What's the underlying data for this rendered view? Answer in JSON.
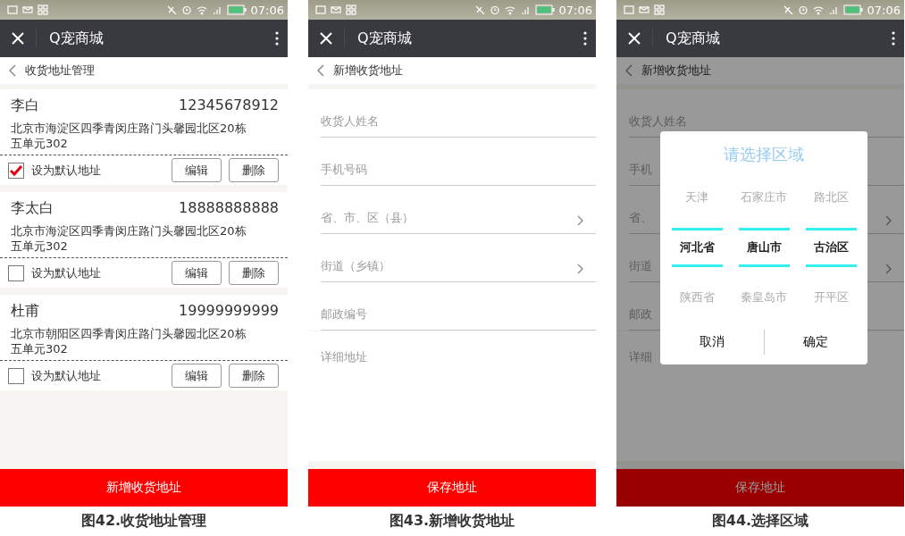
{
  "screens": [
    {
      "kind": "address_list",
      "time": "07:06",
      "app_title": "Q宠商城",
      "page_title": "收货地址管理",
      "addresses": [
        {
          "name": "李白",
          "phone": "12345678912",
          "address": "北京市海淀区四季青闵庄路门头馨园北区20栋五单元302",
          "default_label": "设为默认地址",
          "checked": true,
          "edit": "编辑",
          "delete": "删除"
        },
        {
          "name": "李太白",
          "phone": "18888888888",
          "address": "北京市海淀区四季青闵庄路门头馨园北区20栋五单元302",
          "default_label": "设为默认地址",
          "checked": false,
          "edit": "编辑",
          "delete": "删除"
        },
        {
          "name": "杜甫",
          "phone": "19999999999",
          "address": "北京市朝阳区四季青闵庄路门头馨园北区20栋五单元302",
          "default_label": "设为默认地址",
          "checked": false,
          "edit": "编辑",
          "delete": "删除"
        }
      ],
      "bottom_button": "新增收货地址",
      "caption": "图42.收货地址管理"
    },
    {
      "kind": "new_address",
      "time": "07:06",
      "app_title": "Q宠商城",
      "page_title": "新增收货地址",
      "fields": [
        {
          "placeholder": "收货人姓名",
          "chevron": false
        },
        {
          "placeholder": "手机号码",
          "chevron": false
        },
        {
          "placeholder": "省、市、区（县）",
          "chevron": true
        },
        {
          "placeholder": "街道（乡镇）",
          "chevron": true
        },
        {
          "placeholder": "邮政编号",
          "chevron": false
        }
      ],
      "detail_placeholder": "详细地址",
      "bottom_button": "保存地址",
      "caption": "图43.新增收货地址"
    },
    {
      "kind": "region_picker",
      "time": "07:06",
      "app_title": "Q宠商城",
      "page_title": "新增收货地址",
      "fields": [
        {
          "placeholder": "收货人姓名",
          "chevron": false
        },
        {
          "placeholder": "手机",
          "chevron": false
        },
        {
          "placeholder": "省、",
          "chevron": true
        },
        {
          "placeholder": "街道",
          "chevron": true
        },
        {
          "placeholder": "邮政",
          "chevron": false
        }
      ],
      "detail_placeholder": "详细",
      "bottom_button": "保存地址",
      "caption": "图44.选择区域",
      "dialog": {
        "title": "请选择区域",
        "columns": [
          [
            {
              "label": "天津",
              "selected": false
            },
            {
              "label": "河北省",
              "selected": true
            },
            {
              "label": "陕西省",
              "selected": false
            }
          ],
          [
            {
              "label": "石家庄市",
              "selected": false
            },
            {
              "label": "唐山市",
              "selected": true
            },
            {
              "label": "秦皇岛市",
              "selected": false
            }
          ],
          [
            {
              "label": "路北区",
              "selected": false
            },
            {
              "label": "古治区",
              "selected": true
            },
            {
              "label": "开平区",
              "selected": false
            }
          ]
        ],
        "cancel": "取消",
        "confirm": "确定"
      }
    }
  ]
}
